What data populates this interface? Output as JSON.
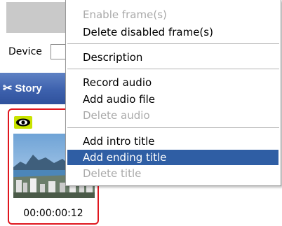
{
  "background": {
    "device_label": "Device",
    "story_label": "Story",
    "clip": {
      "timecode": "00:00:00:12"
    }
  },
  "context_menu": {
    "items": [
      {
        "label": "Enable frame(s)",
        "enabled": false
      },
      {
        "label": "Delete disabled frame(s)",
        "enabled": true
      },
      {
        "label": "Description",
        "enabled": true
      },
      {
        "label": "Record audio",
        "enabled": true
      },
      {
        "label": "Add audio file",
        "enabled": true
      },
      {
        "label": "Delete audio",
        "enabled": false
      },
      {
        "label": "Add intro title",
        "enabled": true
      },
      {
        "label": "Add ending title",
        "enabled": true,
        "highlighted": true
      },
      {
        "label": "Delete title",
        "enabled": false
      }
    ]
  },
  "colors": {
    "menu_highlight": "#2f5ea4",
    "clip_border": "#e0161e",
    "story_bar": "#3d61ad",
    "eye_badge": "#c9e300"
  }
}
